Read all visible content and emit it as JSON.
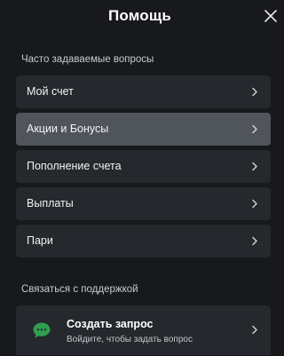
{
  "header": {
    "title": "Помощь"
  },
  "faq": {
    "section_title": "Часто задаваемые вопросы",
    "items": [
      {
        "label": "Мой счет"
      },
      {
        "label": "Акции и Бонусы",
        "active": true
      },
      {
        "label": "Пополнение счета"
      },
      {
        "label": "Выплаты"
      },
      {
        "label": "Пари"
      }
    ]
  },
  "support": {
    "section_title": "Связаться с поддержкой",
    "card_title": "Создать запрос",
    "card_subtitle": "Войдите, чтобы задать вопрос",
    "icon": "chat-bubble-icon",
    "accent_color": "#2e9e4f"
  },
  "colors": {
    "background": "#17191c",
    "item_background": "#25282c",
    "item_active_background": "#50555c"
  }
}
